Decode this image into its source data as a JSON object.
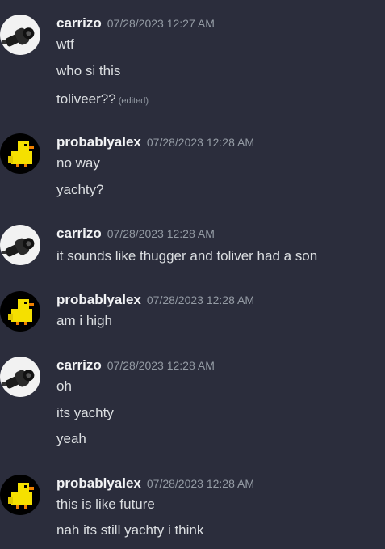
{
  "messages": [
    {
      "username": "carrizo",
      "avatar": "camera-avatar",
      "timestamp": "07/28/2023 12:27 AM",
      "lines": [
        "wtf",
        "who si this",
        "toliveer??"
      ],
      "edited_label": "(edited)"
    },
    {
      "username": "probablyalex",
      "avatar": "duck-avatar",
      "timestamp": "07/28/2023 12:28 AM",
      "lines": [
        "no way",
        "yachty?"
      ]
    },
    {
      "username": "carrizo",
      "avatar": "camera-avatar",
      "timestamp": "07/28/2023 12:28 AM",
      "lines": [
        "it sounds like thugger and toliver had a son"
      ]
    },
    {
      "username": "probablyalex",
      "avatar": "duck-avatar",
      "timestamp": "07/28/2023 12:28 AM",
      "lines": [
        "am i high"
      ]
    },
    {
      "username": "carrizo",
      "avatar": "camera-avatar",
      "timestamp": "07/28/2023 12:28 AM",
      "lines": [
        "oh",
        "its yachty",
        "yeah"
      ]
    },
    {
      "username": "probablyalex",
      "avatar": "duck-avatar",
      "timestamp": "07/28/2023 12:28 AM",
      "lines": [
        "this is like future",
        "nah its still yachty i think"
      ]
    }
  ],
  "colors": {
    "background": "#2b2d3c",
    "username": "#f2f3f5",
    "timestamp": "#949ba4",
    "text": "#dbdee1"
  }
}
